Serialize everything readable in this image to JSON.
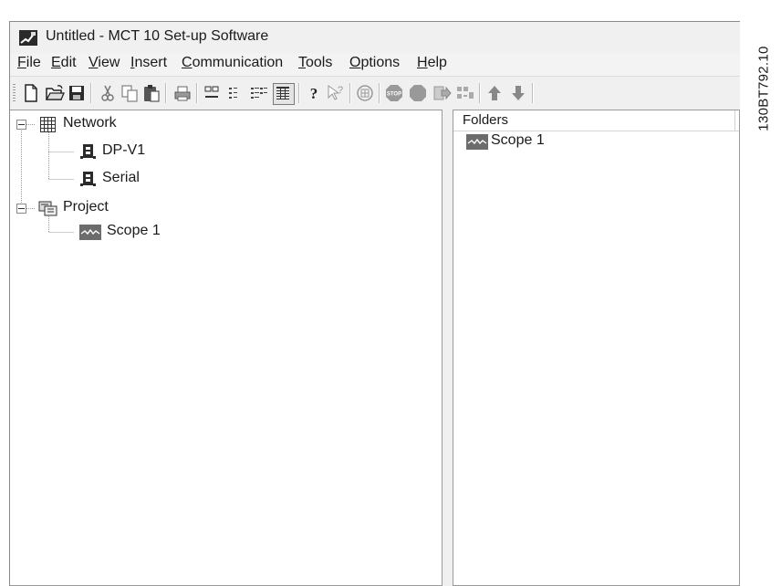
{
  "window": {
    "title": "Untitled - MCT 10 Set-up Software"
  },
  "menubar": {
    "items": [
      {
        "label": "File",
        "mnemonic": "F",
        "rest": "ile"
      },
      {
        "label": "Edit",
        "mnemonic": "E",
        "rest": "dit"
      },
      {
        "label": "View",
        "mnemonic": "V",
        "rest": "iew"
      },
      {
        "label": "Insert",
        "mnemonic": "I",
        "rest": "nsert"
      },
      {
        "label": "Communication",
        "mnemonic": "C",
        "rest": "ommunication"
      },
      {
        "label": "Tools",
        "mnemonic": "T",
        "rest": "ools"
      },
      {
        "label": "Options",
        "mnemonic": "O",
        "rest": "ptions"
      },
      {
        "label": "Help",
        "mnemonic": "H",
        "rest": "elp"
      }
    ]
  },
  "toolbar": {
    "icons": [
      "new-file-icon",
      "open-folder-icon",
      "save-icon",
      "cut-icon",
      "copy-icon",
      "paste-icon",
      "print-icon",
      "large-icons-view-icon",
      "small-icons-view-icon",
      "list-view-icon",
      "details-view-icon",
      "help-icon",
      "context-help-icon",
      "bus-scan-icon",
      "stop-icon",
      "record-icon",
      "write-to-drive-icon",
      "network-scan-icon",
      "up-arrow-icon",
      "down-arrow-icon"
    ]
  },
  "tree": {
    "network": {
      "label": "Network",
      "children": [
        {
          "label": "DP-V1"
        },
        {
          "label": "Serial"
        }
      ]
    },
    "project": {
      "label": "Project",
      "children": [
        {
          "label": "Scope 1"
        }
      ]
    }
  },
  "list": {
    "column_header": "Folders",
    "items": [
      {
        "label": "Scope 1"
      }
    ]
  },
  "side_label": "130BT792.10",
  "colors": {
    "window_bg": "#f3f3f3",
    "pane_bg": "#ffffff",
    "scope_icon": "#6c6c6c"
  }
}
